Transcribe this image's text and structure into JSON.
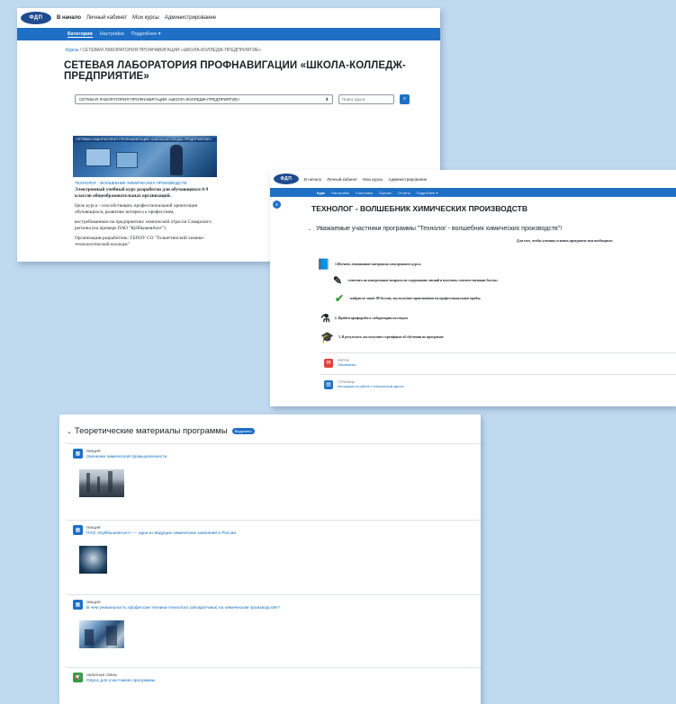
{
  "colors": {
    "background": "#bfd9ef",
    "accent": "#1f6fc5",
    "link": "#0f6cbf",
    "feedback": "#2e9e47",
    "announce": "#e2413b"
  },
  "screen1": {
    "logo_text": "ФДП",
    "top_nav": [
      "В начало",
      "Личный кабинет",
      "Мои курсы",
      "Администрирование"
    ],
    "sub_nav": [
      "Категория",
      "Настройки",
      "Подробнее ▾"
    ],
    "breadcrumb": [
      "Курсы",
      "СЕТЕВАЯ ЛАБОРАТОРИЯ ПРОФНАВИГАЦИИ «ШКОЛА-КОЛЛЕДЖ-ПРЕДПРИЯТИЕ»"
    ],
    "title": "СЕТЕВАЯ ЛАБОРАТОРИЯ ПРОФНАВИГАЦИИ «ШКОЛА-КОЛЛЕДЖ-ПРЕДПРИЯТИЕ»",
    "category_select": "СЕТЕВАЯ ЛАБОРАТОРИЯ ПРОФНАВИГАЦИИ «ШКОЛА-КОЛЛЕДЖ-ПРЕДПРИЯТИЕ»",
    "search_placeholder": "Поиск курса",
    "card": {
      "image_banner": "СЕТЕВАЯ ЛАБОРАТОРИЯ ПРОФНАВИГАЦИИ «ШКОЛА-КОЛЛЕДЖ-ПРЕДПРИЯТИЕ»",
      "course_name": "ТЕХНОЛОГ - ВОЛШЕБНИК ХИМИЧЕСКИХ ПРОИЗВОДСТВ",
      "p1": "Электронный учебный курс разработан для обучающихся 8-9 классов общеобразовательных организаций.",
      "p2": "Цель курса - способствовать профессиональной ориентации обучающихся, развитию интереса к профессиям,",
      "p3": "востребованным на предприятиях химической отрасли Самарского региона (на примере ПАО \"КуйбышевАзот\")",
      "p4": "Организация-разработчик: ГБПОУ СО \"Тольяттинский химико-технологический колледж\""
    }
  },
  "screen2": {
    "top_nav": [
      "В начало",
      "Личный кабинет",
      "Мои курсы",
      "Администрирование"
    ],
    "sub_nav": [
      "Курс",
      "Настройки",
      "Участники",
      "Оценки",
      "Отчеты",
      "Подробнее ▾"
    ],
    "title": "ТЕХНОЛОГ - ВОЛШЕБНИК ХИМИЧЕСКИХ ПРОИЗВОДСТВ",
    "section_title": "Уважаемые участники программы \"Технолог - волшебник химических производств\"!",
    "intro": "Для того, чтобы успешно освоить программу вам необходимо:",
    "steps": [
      "1.Изучить лекционные материалы электронного курса:",
      "- ответить на контрольные вопросы по содержанию лекций и получить соответствующие баллы;",
      "- набрав не менее 80 баллов, вы получите приглашение на профессиональные пробы.",
      "2. Пройти профпробы в лаборатории колледжа",
      "3. В результате, вы получите сертификат об обучении по программе"
    ],
    "activities": [
      {
        "type": "ФОРУМ",
        "name": "Объявления"
      },
      {
        "type": "СТРАНИЦА",
        "name": "Инструкция по работе с электронным курсом"
      }
    ]
  },
  "screen3": {
    "section_title": "Теоретические материалы программы",
    "badge": "Выделено",
    "items": [
      {
        "type": "ЛЕКЦИЯ",
        "name": "Значение химической промышленности"
      },
      {
        "type": "ЛЕКЦИЯ",
        "name": "ПАО «КуйбышевАзот» — одна из ведущих химических компаний в России"
      },
      {
        "type": "ЛЕКЦИЯ",
        "name": "В чем уникальность профессии техника-технолога (аппаратчика) на химическом производстве?"
      },
      {
        "type": "ОБРАТНАЯ СВЯЗЬ",
        "name": "Опрос для участников программы"
      }
    ]
  }
}
